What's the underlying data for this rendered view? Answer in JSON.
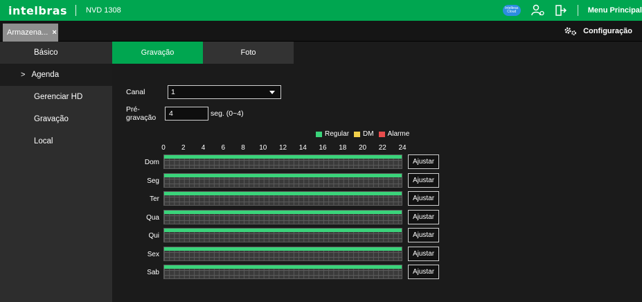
{
  "header": {
    "logo": "intelbras",
    "model": "NVD 1308",
    "cloud_label": "Intelbras Cloud",
    "menu_principal": "Menu Principal"
  },
  "tabbar": {
    "doc_tab": "Armazena...",
    "doc_tab_close": "×",
    "config_label": "Configuração"
  },
  "sidebar": {
    "items": [
      {
        "label": "Básico",
        "active": false
      },
      {
        "label": "Agenda",
        "active": true,
        "arrow": ">"
      },
      {
        "label": "Gerenciar HD",
        "active": false
      },
      {
        "label": "Gravação",
        "active": false
      },
      {
        "label": "Local",
        "active": false
      }
    ]
  },
  "subtabs": [
    {
      "label": "Gravação",
      "active": true
    },
    {
      "label": "Foto",
      "active": false
    }
  ],
  "form": {
    "canal_label": "Canal",
    "canal_value": "1",
    "pregravacao_label": "Pré-gravação",
    "pregravacao_value": "4",
    "pregravacao_unit": "seg. (0~4)"
  },
  "legend": [
    {
      "label": "Regular",
      "color": "#3ad37a"
    },
    {
      "label": "DM",
      "color": "#f1d04a"
    },
    {
      "label": "Alarme",
      "color": "#e84c4c"
    }
  ],
  "hours": [
    "0",
    "2",
    "4",
    "6",
    "8",
    "10",
    "12",
    "14",
    "16",
    "18",
    "20",
    "22",
    "24"
  ],
  "schedule": {
    "days": [
      "Dom",
      "Seg",
      "Ter",
      "Qua",
      "Qui",
      "Sex",
      "Sab"
    ],
    "adjust_label": "Ajustar",
    "regular_coverage": [
      1,
      1,
      1,
      1,
      1,
      1,
      1
    ]
  },
  "colors": {
    "brand_green": "#00a650",
    "regular": "#3ad37a"
  }
}
